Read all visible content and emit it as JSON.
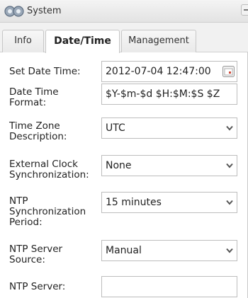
{
  "titlebar": {
    "title": "System",
    "icon": "gears-icon"
  },
  "tabs": [
    {
      "label": "Info"
    },
    {
      "label": "Date/Time"
    },
    {
      "label": "Management"
    }
  ],
  "form": {
    "set_date_time": {
      "label": "Set Date Time:",
      "value": "2012-07-04 12:47:00"
    },
    "date_time_format": {
      "label_line1": "Date Time",
      "label_line2": "Format:",
      "value": "$Y-$m-$d $H:$M:$S $Z"
    },
    "time_zone": {
      "label_line1": "Time Zone",
      "label_line2": "Description:",
      "value": "UTC"
    },
    "external_clock": {
      "label_line1": "External Clock",
      "label_line2": "Synchronization:",
      "value": "None"
    },
    "ntp_period": {
      "label_line1": "NTP",
      "label_line2": "Synchronization",
      "label_line3": "Period:",
      "value": "15 minutes"
    },
    "ntp_source": {
      "label_line1": "NTP Server",
      "label_line2": "Source:",
      "value": "Manual"
    },
    "ntp_server": {
      "label": "NTP Server:",
      "value": ""
    }
  }
}
